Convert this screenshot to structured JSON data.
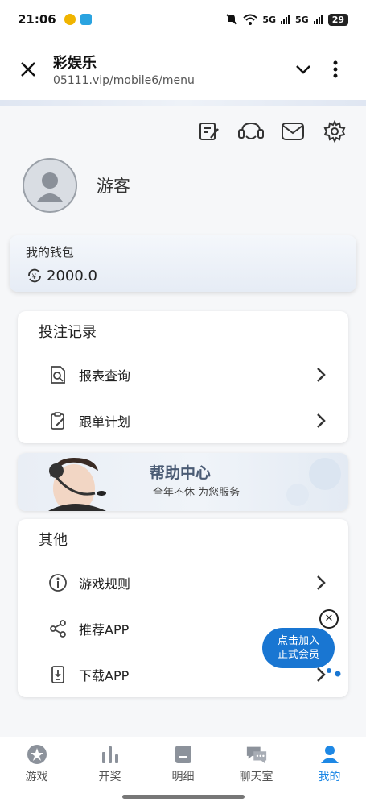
{
  "status_bar": {
    "time": "21:06",
    "signal_1": "5G",
    "signal_2": "5G",
    "battery": "29"
  },
  "browser": {
    "title": "彩娱乐",
    "url": "05111.vip/mobile6/menu"
  },
  "profile": {
    "username": "游客"
  },
  "wallet": {
    "label": "我的钱包",
    "amount": "2000.0"
  },
  "bet_records": {
    "title": "投注记录",
    "items": [
      {
        "label": "报表查询",
        "icon": "report-search-icon"
      },
      {
        "label": "跟单计划",
        "icon": "follow-plan-icon"
      }
    ]
  },
  "help_center": {
    "title": "帮助中心",
    "subtitle": "全年不休 为您服务"
  },
  "others": {
    "title": "其他",
    "items": [
      {
        "label": "游戏规则",
        "icon": "info-icon"
      },
      {
        "label": "推荐APP",
        "icon": "share-icon"
      },
      {
        "label": "下载APP",
        "icon": "download-icon"
      }
    ]
  },
  "join_popup": {
    "line1": "点击加入",
    "line2": "正式会员"
  },
  "tabs": [
    {
      "label": "游戏",
      "icon": "game-icon"
    },
    {
      "label": "开奖",
      "icon": "results-chart-icon"
    },
    {
      "label": "明细",
      "icon": "details-icon"
    },
    {
      "label": "聊天室",
      "icon": "chat-icon"
    },
    {
      "label": "我的",
      "icon": "profile-icon",
      "active": true
    }
  ],
  "colors": {
    "accent": "#1e88e5",
    "join_bg": "#1976d2"
  }
}
